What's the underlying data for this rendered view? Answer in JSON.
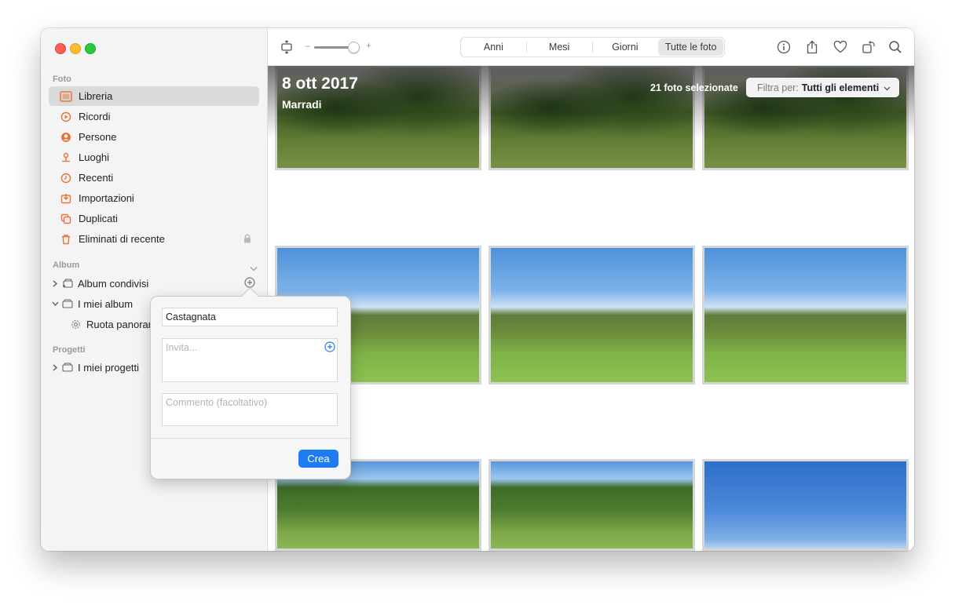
{
  "sidebar": {
    "section_foto": "Foto",
    "items": [
      {
        "label": "Libreria",
        "icon": "library-icon",
        "selected": true
      },
      {
        "label": "Ricordi",
        "icon": "memories-icon"
      },
      {
        "label": "Persone",
        "icon": "people-icon"
      },
      {
        "label": "Luoghi",
        "icon": "places-icon"
      },
      {
        "label": "Recenti",
        "icon": "recents-icon"
      },
      {
        "label": "Importazioni",
        "icon": "imports-icon"
      },
      {
        "label": "Duplicati",
        "icon": "duplicates-icon"
      },
      {
        "label": "Eliminati di recente",
        "icon": "trash-icon",
        "locked": true
      }
    ],
    "section_album": "Album",
    "shared_albums": "Album condivisi",
    "my_albums": "I miei album",
    "my_albums_child": "Ruota panoram",
    "section_projects": "Progetti",
    "my_projects": "I miei progetti"
  },
  "toolbar": {
    "zoom_minus": "−",
    "zoom_plus": "+",
    "zoom_level": 0.85,
    "tabs": [
      "Anni",
      "Mesi",
      "Giorni",
      "Tutte le foto"
    ],
    "active_tab": "Tutte le foto"
  },
  "header": {
    "date": "8 ott 2017",
    "place": "Marradi",
    "selected_count": "21 foto selezionate",
    "filter_label": "Filtra per:",
    "filter_value": "Tutti gli elementi"
  },
  "popover": {
    "album_name": "Castagnata",
    "invite_placeholder": "Invita...",
    "comment_placeholder": "Commento (facoltativo)",
    "create_label": "Crea"
  },
  "colors": {
    "accent": "#1e7cf2",
    "sidebar_icon": "#e8743b"
  }
}
